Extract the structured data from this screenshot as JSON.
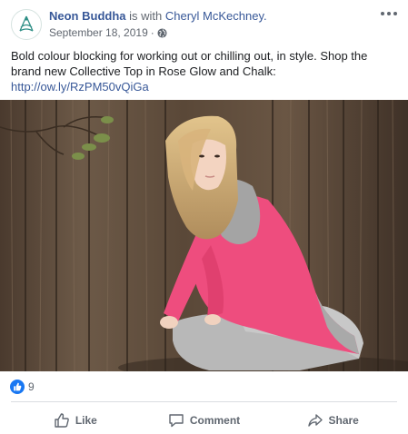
{
  "post": {
    "page_name": "Neon Buddha",
    "with_text": "is with",
    "tagged_name": "Cheryl McKechney.",
    "date": "September 18, 2019",
    "date_separator": "·",
    "icons": {
      "avatar": "neon-buddha-logo",
      "privacy": "globe-icon",
      "menu": "more-options-icon"
    },
    "body_text": "Bold colour blocking for working out or chilling out, in style. Shop the brand new Collective Top in Rose Glow and Chalk:",
    "link_text": "http://ow.ly/RzPM50vQiGa"
  },
  "reactions": {
    "count": "9",
    "type": "like"
  },
  "actions": [
    {
      "label": "Like",
      "icon": "thumbs-up-icon"
    },
    {
      "label": "Comment",
      "icon": "comment-icon"
    },
    {
      "label": "Share",
      "icon": "share-icon"
    }
  ],
  "colors": {
    "link": "#385898",
    "secondary_text": "#606770",
    "like_blue": "#1877f2",
    "sweater_pink": "#ee4d7e",
    "wood": "#5c4838"
  }
}
